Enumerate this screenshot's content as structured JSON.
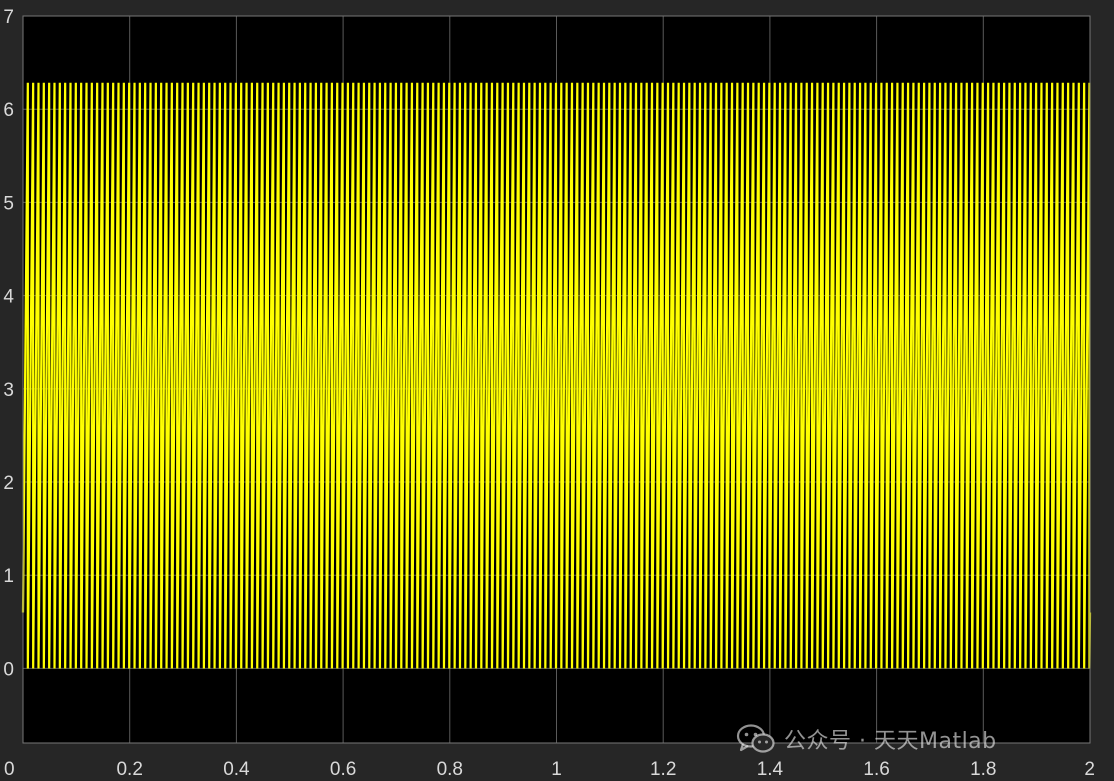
{
  "watermark": {
    "text": "公众号 · 天天Matlab",
    "icon": "wechat-logo-icon"
  },
  "colors": {
    "figure_background": "#262626",
    "axes_background": "#000000",
    "grid": "#5a5a5a",
    "tick_text": "#d9d9d9",
    "signal": "#ffff00"
  },
  "chart_data": {
    "type": "line",
    "title": "",
    "xlabel": "",
    "ylabel": "",
    "xlim": [
      0,
      2
    ],
    "ylim": [
      -0.8,
      7
    ],
    "x_ticks": [
      0,
      0.2,
      0.4,
      0.6,
      0.8,
      1,
      1.2,
      1.4,
      1.6,
      1.8,
      2
    ],
    "x_tick_labels": [
      "0",
      "0.2",
      "0.4",
      "0.6",
      "0.8",
      "1",
      "1.2",
      "1.4",
      "1.6",
      "1.8",
      "2"
    ],
    "y_ticks": [
      0,
      1,
      2,
      3,
      4,
      5,
      6,
      7
    ],
    "y_tick_labels": [
      "0",
      "1",
      "2",
      "3",
      "4",
      "5",
      "6",
      "7"
    ],
    "grid": true,
    "legend": "none",
    "series": [
      {
        "shape": "sawtooth",
        "min": 0,
        "max": 6.2832,
        "period": 0.01,
        "phase_start_value": 0.6,
        "x_start": 0,
        "x_end": 2,
        "color": "#ffff00"
      }
    ]
  }
}
